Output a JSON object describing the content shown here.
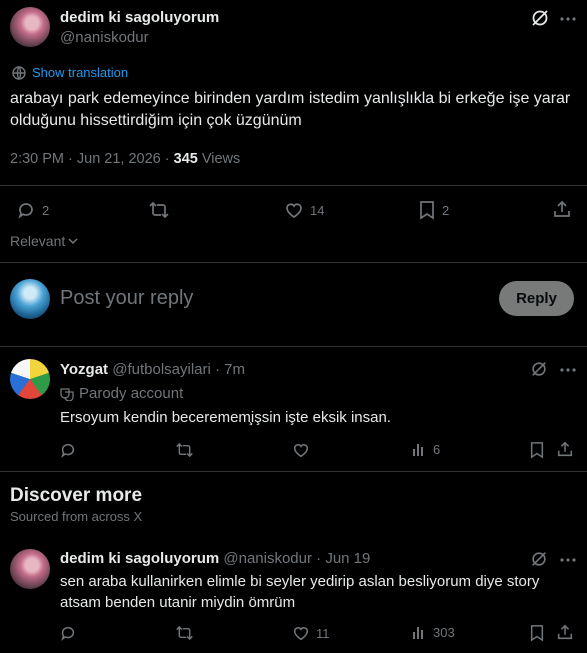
{
  "main_post": {
    "display_name": "dedim ki sagoluyorum",
    "handle": "@naniskodur",
    "show_translation": "Show translation",
    "text": "arabayı park edemeyince birinden yardım istedim yanlışlıkla bi erkeğe işe yarar olduğunu hissettirdiğim için çok üzgünüm",
    "timestamp": "2:30 PM · Jun 21, 2026 ·",
    "views_count": "345",
    "views_label": "Views",
    "reply_count": "2",
    "like_count": "14",
    "bookmark_count": "2"
  },
  "sort": {
    "label": "Relevant"
  },
  "composer": {
    "placeholder": "Post your reply",
    "reply_button": "Reply"
  },
  "reply": {
    "display_name": "Yozgat",
    "handle": "@futbolsayilari",
    "time": "· 7m",
    "parody_label": "Parody account",
    "text": "Ersoyum kendin beceremem̧işsin işte eksik insan.",
    "views_count": "6"
  },
  "discover": {
    "title": "Discover more",
    "subtitle": "Sourced from across X"
  },
  "discover_post": {
    "display_name": "dedim ki sagoluyorum",
    "handle": "@naniskodur",
    "time": "· Jun 19",
    "text": "sen araba kullanirken elimle bi seyler yedirip aslan besliyorum diye story atsam benden utanir miydin ömrüm",
    "like_count": "11",
    "views_count": "303"
  },
  "colors": {
    "accent": "#1d9bf0",
    "muted": "#71767b",
    "divider": "#2f3336"
  }
}
